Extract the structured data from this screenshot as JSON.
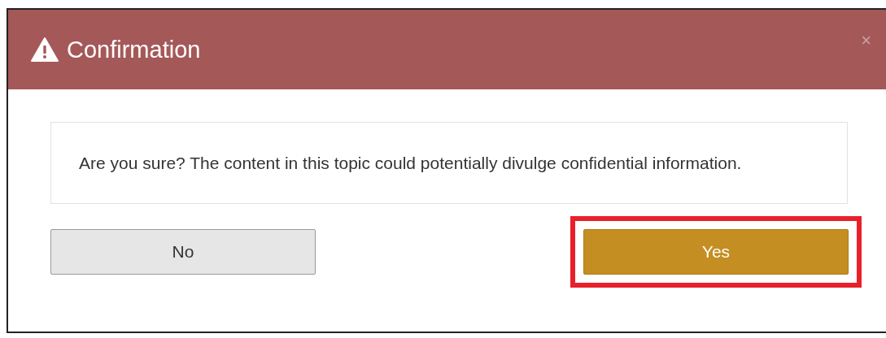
{
  "dialog": {
    "title": "Confirmation",
    "close": "×",
    "message": "Are you sure? The content in this topic could potentially divulge confidential information.",
    "buttons": [
      {
        "label": "No",
        "kind": "secondary",
        "highlighted": false
      },
      {
        "label": "Yes",
        "kind": "primary",
        "highlighted": true
      }
    ]
  }
}
